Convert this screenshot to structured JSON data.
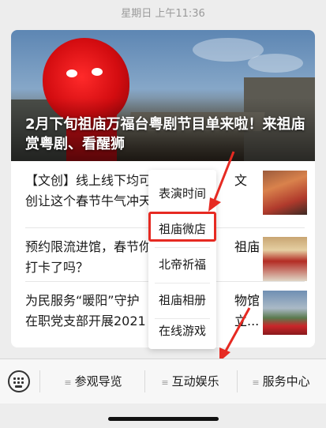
{
  "status_bar": {
    "timestamp": "星期日 上午11:36"
  },
  "card": {
    "hero_title": "2月下旬祖庙万福台粤剧节目单来啦！来祖庙赏粤剧、看醒狮",
    "articles": [
      {
        "title": "【文创】线上线下均可\n创让这个春节牛气冲天",
        "title_tail": "文"
      },
      {
        "title": "预约限流进馆，春节你\n打卡了吗？",
        "title_tail": "祖庙"
      },
      {
        "title": "为民服务“暖阳”守护\n在职党支部开展2021",
        "title_tail": "物馆\n立..."
      }
    ]
  },
  "popup_menu": {
    "items": [
      {
        "label": "表演时间"
      },
      {
        "label": "祖庙微店"
      },
      {
        "label": "北帝祈福"
      },
      {
        "label": "祖庙相册"
      },
      {
        "label": "在线游戏"
      }
    ]
  },
  "tab_bar": {
    "keyboard_icon": "keyboard-icon",
    "tabs": [
      {
        "label": "参观导览"
      },
      {
        "label": "互动娱乐"
      },
      {
        "label": "服务中心"
      }
    ]
  },
  "colors": {
    "highlight": "#e62a22",
    "accent_red": "#d30c10"
  }
}
